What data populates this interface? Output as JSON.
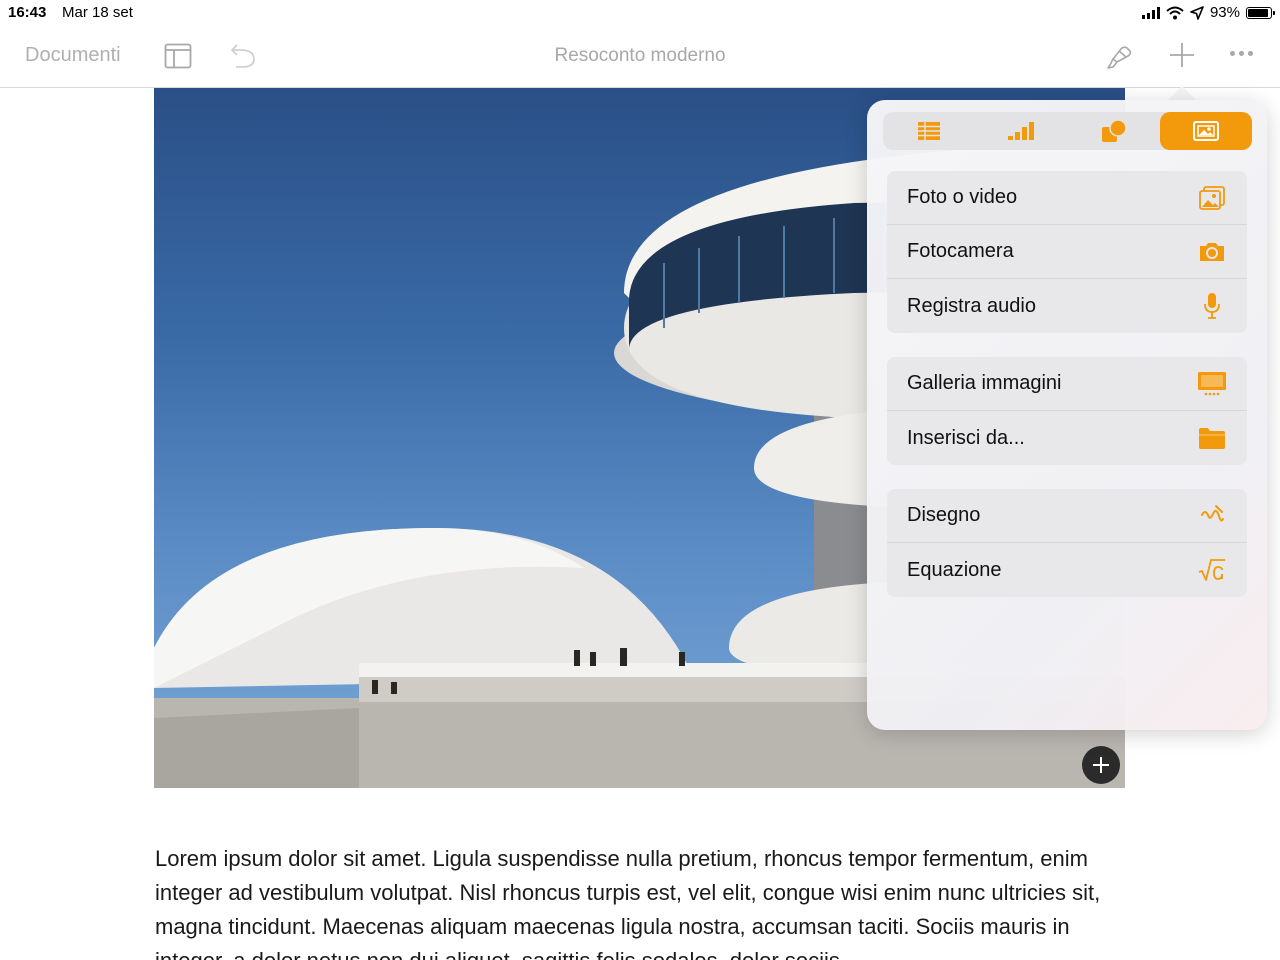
{
  "status_bar": {
    "time": "16:43",
    "date": "Mar 18 set",
    "battery": "93%",
    "battery_level": 0.93
  },
  "toolbar": {
    "documents_label": "Documenti",
    "title": "Resoconto moderno"
  },
  "popover": {
    "tabs": [
      {
        "icon": "table-icon"
      },
      {
        "icon": "chart-icon"
      },
      {
        "icon": "shapes-icon"
      },
      {
        "icon": "media-icon",
        "active": true
      }
    ],
    "groups": [
      {
        "items": [
          {
            "label": "Foto o video",
            "icon": "photo-icon"
          },
          {
            "label": "Fotocamera",
            "icon": "camera-icon"
          },
          {
            "label": "Registra audio",
            "icon": "microphone-icon"
          }
        ]
      },
      {
        "items": [
          {
            "label": "Galleria immagini",
            "icon": "gallery-icon"
          },
          {
            "label": "Inserisci da...",
            "icon": "folder-icon"
          }
        ]
      },
      {
        "items": [
          {
            "label": "Disegno",
            "icon": "drawing-icon"
          },
          {
            "label": "Equazione",
            "icon": "equation-icon"
          }
        ]
      }
    ]
  },
  "body_text": "Lorem ipsum dolor sit amet. Ligula suspendisse nulla pretium, rhoncus tempor fermentum, enim integer ad vestibulum volutpat. Nisl rhoncus turpis est, vel elit, congue wisi enim nunc ultricies sit, magna tincidunt. Maecenas aliquam maecenas ligula nostra, accumsan taciti. Sociis mauris in integer, a dolor netus non dui aliquet, sagittis felis sodales, dolor sociis",
  "colors": {
    "accent": "#f29a0c",
    "toolbar_gray": "#a8a8a8"
  }
}
